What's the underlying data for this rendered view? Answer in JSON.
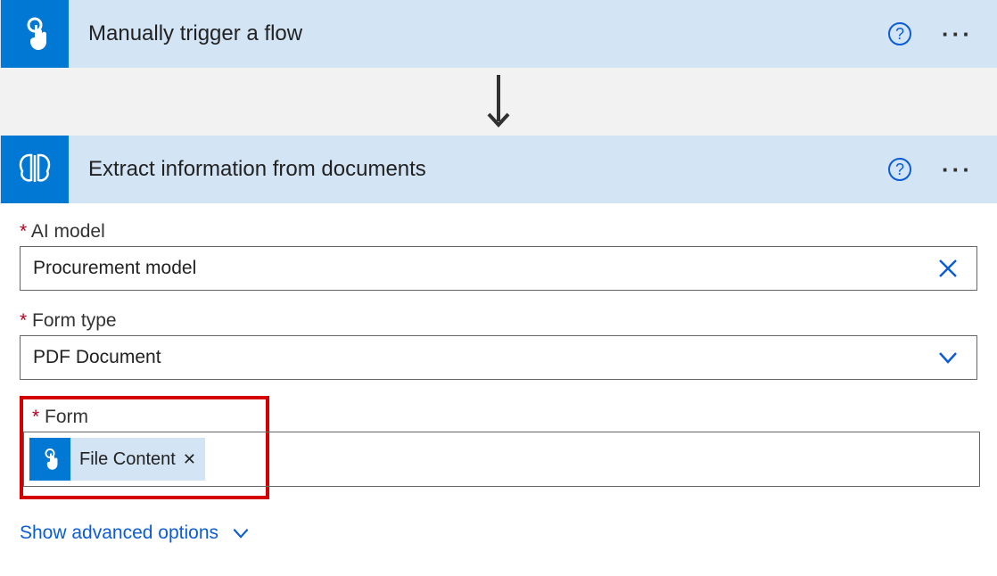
{
  "steps": {
    "trigger": {
      "title": "Manually trigger a flow"
    },
    "action": {
      "title": "Extract information from documents"
    }
  },
  "fields": {
    "ai_model": {
      "label": "AI model",
      "required_marker": "*",
      "value": "Procurement model"
    },
    "form_type": {
      "label": "Form type",
      "required_marker": "*",
      "value": "PDF Document"
    },
    "form": {
      "label": "Form",
      "required_marker": "*",
      "token": "File Content"
    }
  },
  "advanced_toggle": "Show advanced options",
  "colors": {
    "accent": "#0078d4",
    "header_bg": "#d3e4f4",
    "link": "#0b5cd6",
    "highlight": "#d40000"
  }
}
